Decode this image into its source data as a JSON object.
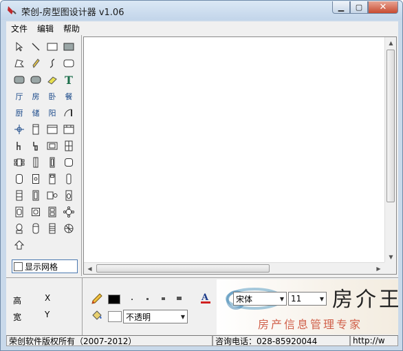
{
  "window": {
    "title": "荣创-房型图设计器 v1.06",
    "accent": "#c84b31"
  },
  "menu": [
    {
      "label": "文件"
    },
    {
      "label": "编辑"
    },
    {
      "label": "帮助"
    }
  ],
  "palette": {
    "room_labels": [
      "厅",
      "房",
      "卧",
      "餐",
      "厨",
      "储",
      "阳"
    ],
    "text_tool": "T",
    "show_grid_label": "显示网格"
  },
  "props": {
    "height_label": "高",
    "width_label": "宽",
    "x_label": "X",
    "y_label": "Y",
    "line_color": "#000000",
    "fill_color": "#ffffff",
    "font_color": "#000080",
    "opacity": "不透明",
    "font_name": "宋体",
    "font_size": "11"
  },
  "logo": {
    "main": "房介王",
    "sub": "房产信息管理专家"
  },
  "status": {
    "copyright": "荣创软件版权所有（2007-2012）",
    "phone": "咨询电话：028-85920044",
    "url": "http://w"
  }
}
